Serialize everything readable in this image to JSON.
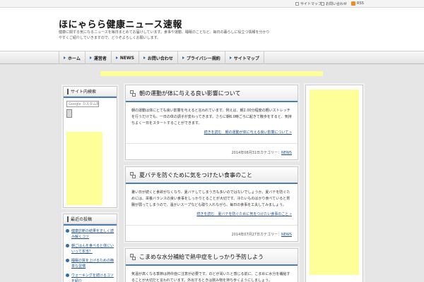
{
  "topbar": {
    "link1": "サイトマップ",
    "link2": "お問い合わせ",
    "rss": "RSS"
  },
  "header": {
    "title": "ほにゃらら健康ニュース速報",
    "description": "健康に関する気になるニュースを毎日まとめてお届けしています。食事や運動、睡眠のことなど、毎日の暮らしに役立つ情報を分かりやすくご紹介していきますので、どうぞよろしくお願いします。"
  },
  "nav": {
    "items": [
      {
        "label": "ホーム"
      },
      {
        "label": "運営者"
      },
      {
        "label": "NEWS"
      },
      {
        "label": "お問い合わせ"
      },
      {
        "label": "プライバシー規約"
      },
      {
        "label": "サイトマップ"
      }
    ]
  },
  "sidebar": {
    "search_title": "サイト内検索",
    "search_placeholder": "Google カスタム検索",
    "recent_title": "最近の投稿",
    "recent": [
      {
        "label": "健康診断の結果を正しく読み解くコツ"
      },
      {
        "label": "朝ごはんを食べると体にいいって本当？"
      },
      {
        "label": "睡眠の質を上げるための簡単な習慣"
      },
      {
        "label": "ウォーキングを続けるコツを紹介"
      }
    ]
  },
  "posts": [
    {
      "title": "朝の運動が体に与える良い影響について",
      "body": "朝の運動は体にとても良い影響を与えると言われています。例えば、朝2.00分程度の軽いストレッチを行うだけでも、一日の体の調子が変わってきます。さらに朝6.0時ごろに起きて散歩をすると、気持ちよく一日をスタートすることができます。",
      "more": "続きを読む　朝の運動が体に与える良い影響について »",
      "date": "2014年08月31日",
      "cat_label": "カテゴリー：",
      "category": "NEWS"
    },
    {
      "title": "夏バテを防ぐために気をつけたい食事のこと",
      "body": "暑い日が続くと食欲がなくなり、夏バテしてしまう方も多いのではないでしょうか。夏バテを防ぐためには、栄養バランスの良い食事をしっかりとることが大切です。冷たいものばかり食べていると胃腸が弱ってしまうので、温かいスープなども取り入れながら、毎日の食事を工夫してみましょう。",
      "more": "続きを読む　夏バテを防ぐために気をつけたい食事のこと »",
      "date": "2014年07月27日",
      "cat_label": "カテゴリー：",
      "category": "NEWS"
    },
    {
      "title": "こまめな水分補給で熱中症をしっかり予防しよう",
      "body": "気温が高くなる季節は熱中症に注意が必要です。のどが渇いたと感じる前に、こまめに水分を補給することが大切だと言われています。外出するときは飲み物を持ち歩くようにしましょう。"
    }
  ]
}
